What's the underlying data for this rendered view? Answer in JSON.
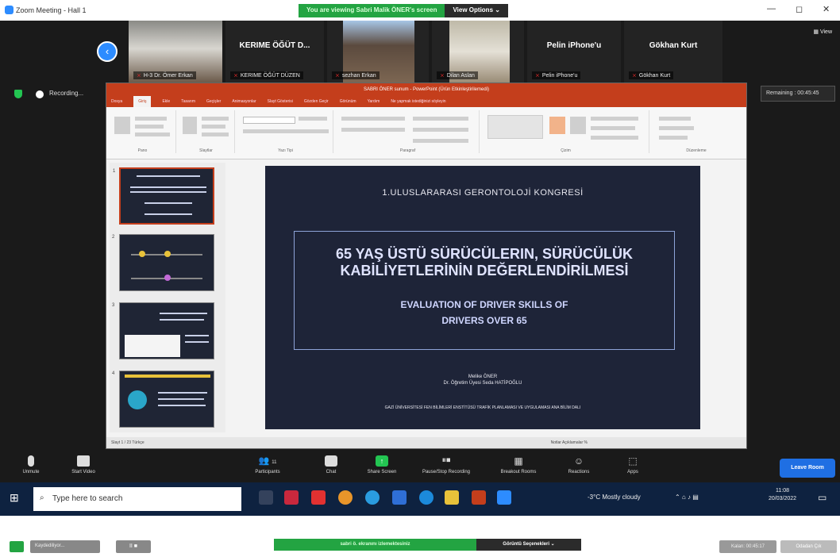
{
  "window": {
    "title": "Zoom Meeting - Hall 1",
    "minimize": "—",
    "maximize": "◻",
    "close": "✕"
  },
  "share_banner": {
    "status": "You are viewing Sabri Malik ÖNER's screen",
    "view_options": "View Options ⌄"
  },
  "gallery": {
    "tiles": [
      {
        "name": "H-3 Dr. Ömer Erkan",
        "label": ""
      },
      {
        "name": "KERIME ÖĞÜT DÜZEN",
        "label": "KERIME ÖĞÜT D..."
      },
      {
        "name": "sezhan Erkan",
        "label": ""
      },
      {
        "name": "Dilan Aslan",
        "label": ""
      },
      {
        "name": "Pelin iPhone'u",
        "label": "Pelin iPhone'u"
      },
      {
        "name": "Gökhan Kurt",
        "label": "Gökhan Kurt"
      }
    ],
    "view": "View"
  },
  "status_row": {
    "recording": "Recording...",
    "remaining": "Remaining : 00:45:45"
  },
  "ppt": {
    "title": "SABRI ÖNER sunum - PowerPoint (Ürün Etkinleştirilemedi)",
    "tabs": [
      "Dosya",
      "Giriş",
      "Ekle",
      "Tasarım",
      "Geçişler",
      "Animasyonlar",
      "Slayt Gösterisi",
      "Gözden Geçir",
      "Görünüm",
      "Yardım",
      "Ne yapmak istediğinizi söyleyin"
    ],
    "ribbon_groups": [
      "Pano",
      "Slaytlar",
      "Yazı Tipi",
      "Paragraf",
      "Çizim",
      "Düzenleme"
    ],
    "status": "Slayt 1 / 23   Türkçe",
    "status_right": "Notlar   Açıklamalar   %"
  },
  "slide": {
    "kongre": "1.ULUSLARARASI GERONTOLOJİ KONGRESİ",
    "title_tr": "65 YAŞ ÜSTÜ SÜRÜCÜLERIN, SÜRÜCÜLÜK KABİLİYETLERİNİN DEĞERLENDİRİLMESİ",
    "title_en": "EVALUATION OF DRIVER SKILLS OF DRIVERS OVER 65",
    "author1": "Melike ÖNER",
    "author2": "Dr. Öğretim Üyesi Seda HATİPOĞLU",
    "university": "GAZİ ÜNİVERSİTESİ FEN BİLİMLERİ ENSTİTÜSÜ TRAFİK PLANLAMASI VE UYGULAMASI ANA BİLİM DALI"
  },
  "controls": {
    "unmute": "Unmute",
    "start_video": "Start Video",
    "participants": "Participants",
    "participants_count": "11",
    "chat": "Chat",
    "share": "Share Screen",
    "pause_rec": "Pause/Stop Recording",
    "breakout": "Breakout Rooms",
    "reactions": "Reactions",
    "apps": "Apps",
    "leave": "Leave Room"
  },
  "taskbar": {
    "search": "Type here to search",
    "weather": "-3°C  Mostly cloudy",
    "time": "11:08",
    "date": "20/03/2022"
  },
  "bottom": {
    "recording": "Kaydediliyor...",
    "controls": "II ■",
    "banner": "sabri ö. ekranını izlemektesiniz",
    "view": "Görüntü Seçenekleri ⌄",
    "remaining": "Kalan: 00:45:17",
    "leave": "Odadan Çık"
  }
}
